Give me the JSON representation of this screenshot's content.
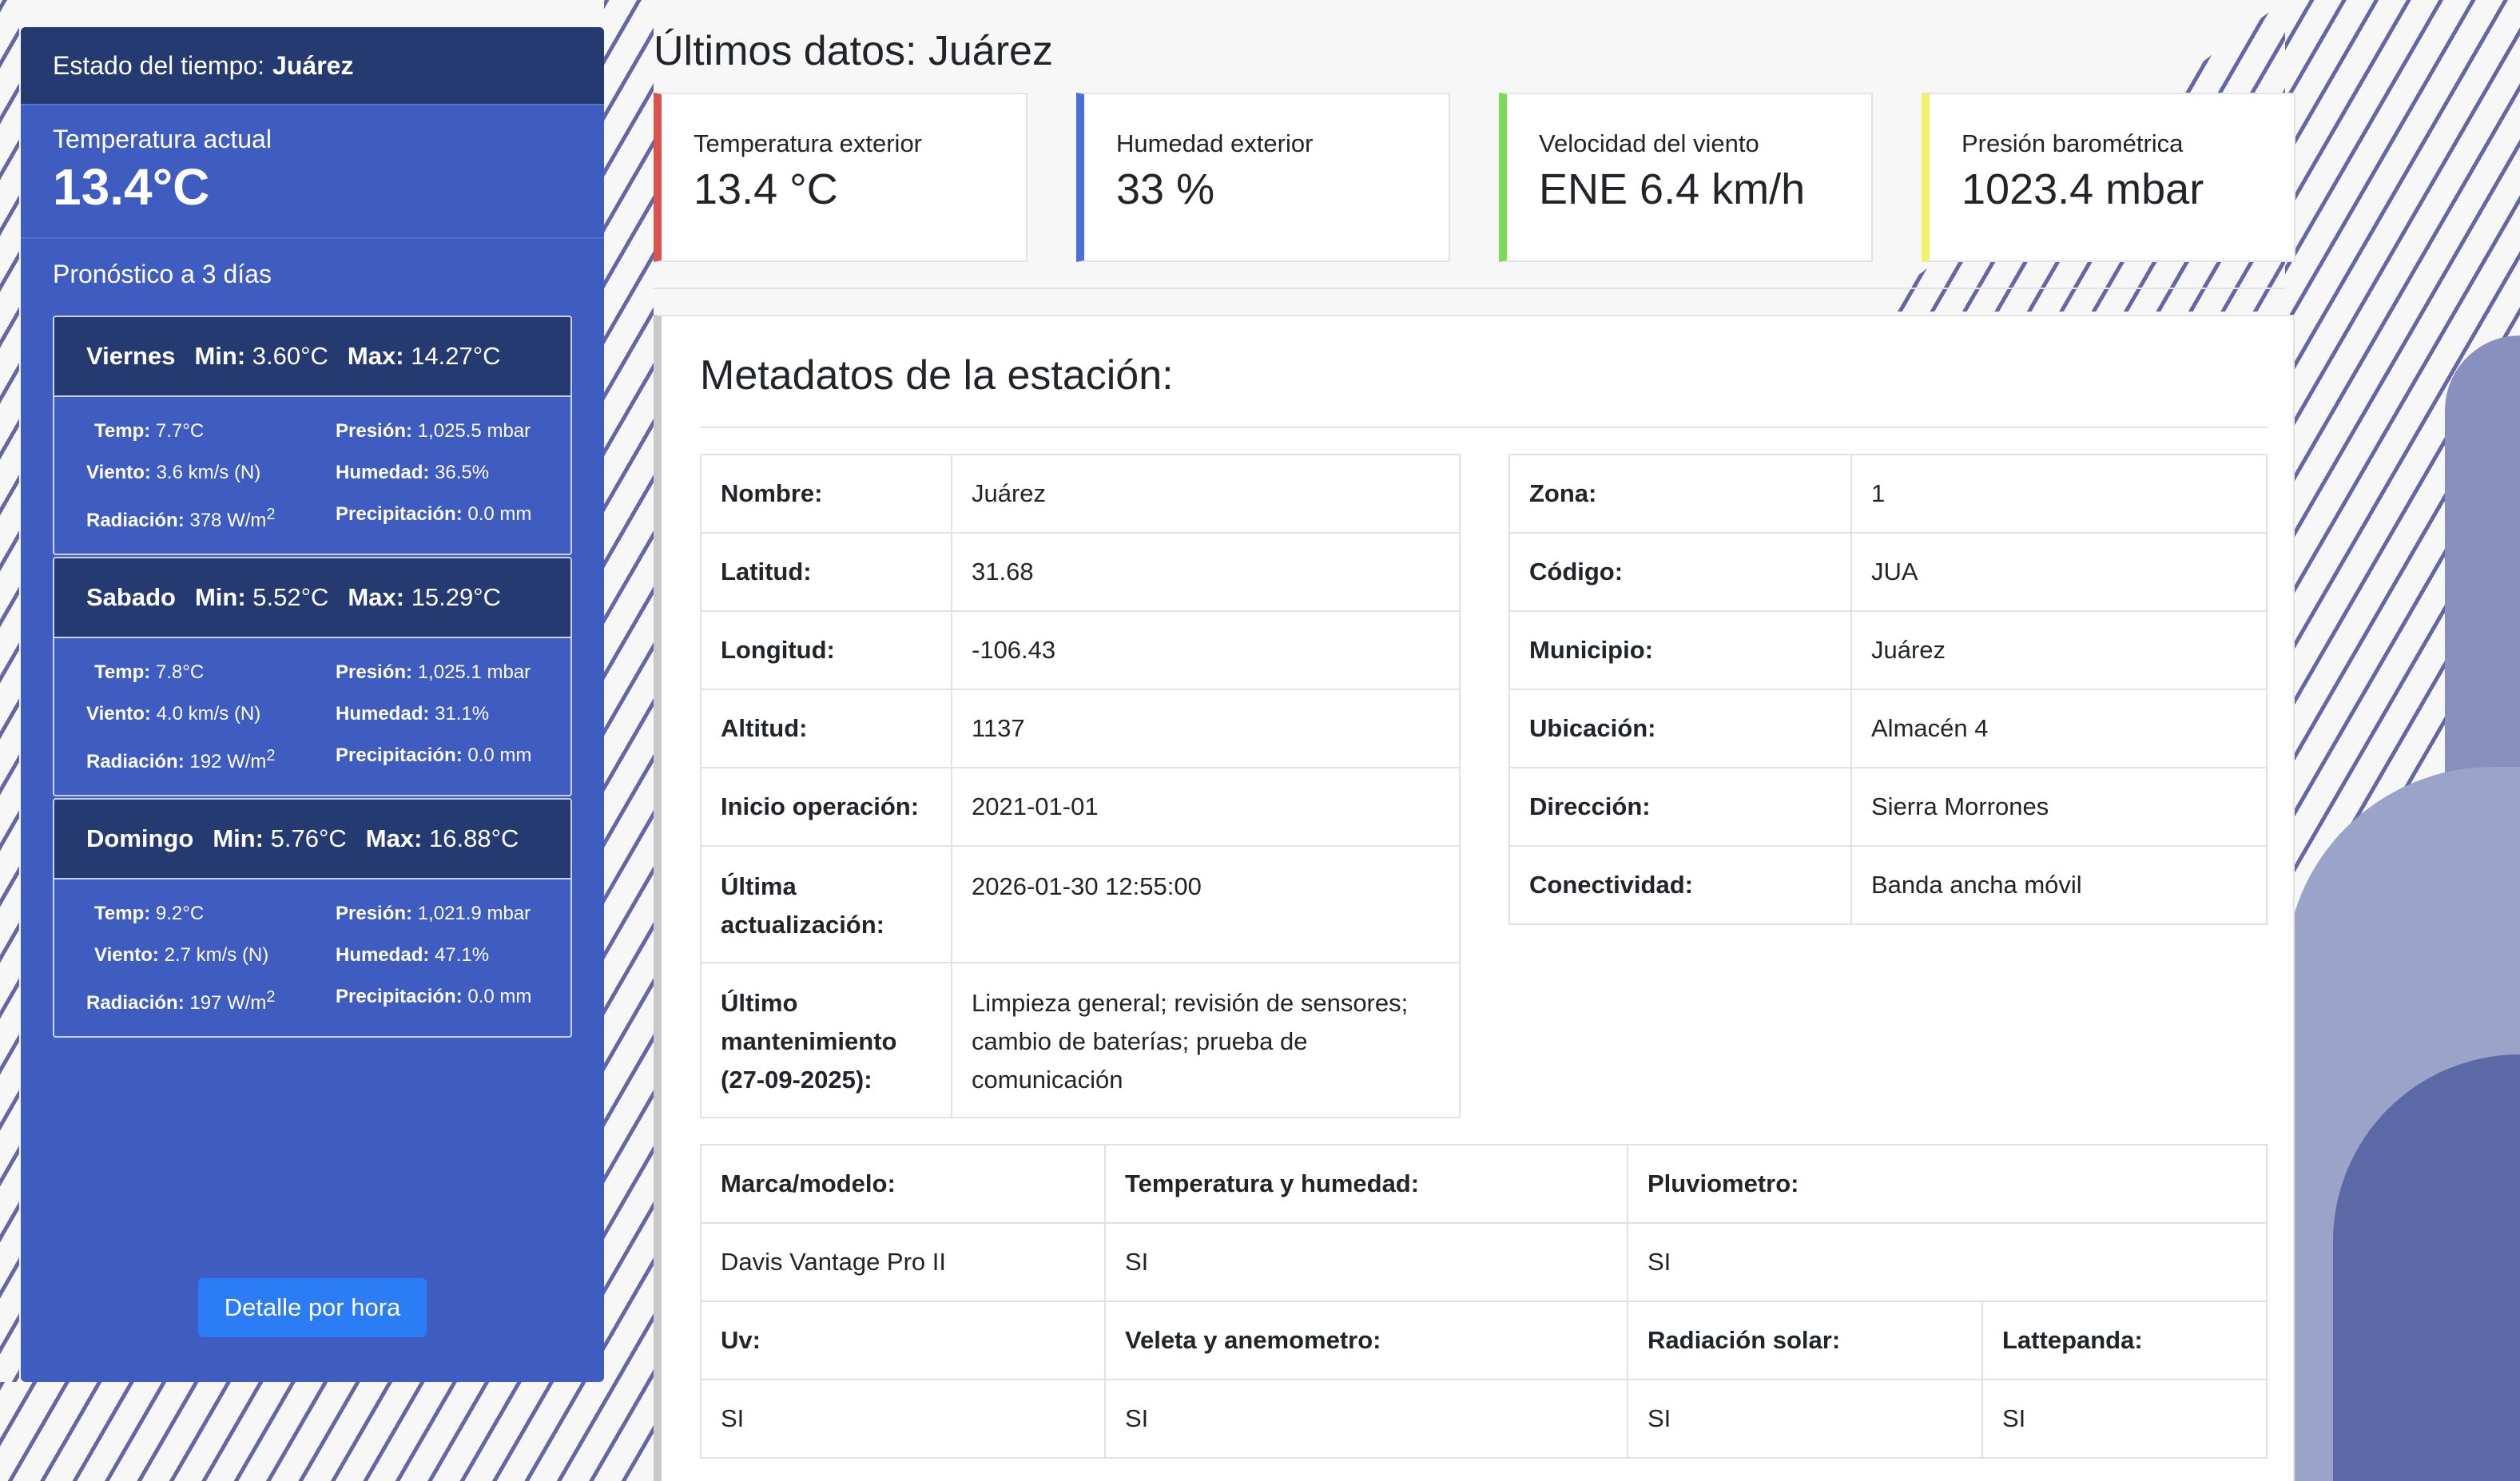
{
  "sidebar": {
    "header_prefix": "Estado del tiempo:",
    "header_station": "Juárez",
    "current_label": "Temperatura actual",
    "current_value": "13.4°C",
    "forecast_title": "Pronóstico a 3 días",
    "days": [
      {
        "name": "Viernes",
        "min_label": "Min:",
        "min": "3.60°C",
        "max_label": "Max:",
        "max": "14.27°C",
        "temp_label": "Temp:",
        "temp": "7.7°C",
        "pres_label": "Presión:",
        "pres": "1,025.5 mbar",
        "wind_label": "Viento:",
        "wind": "3.6 km/s (N)",
        "hum_label": "Humedad:",
        "hum": "36.5%",
        "rad_label": "Radiación:",
        "rad": "378 W/m",
        "rad_sup": "2",
        "prec_label": "Precipitación:",
        "prec": "0.0 mm"
      },
      {
        "name": "Sabado",
        "min_label": "Min:",
        "min": "5.52°C",
        "max_label": "Max:",
        "max": "15.29°C",
        "temp_label": "Temp:",
        "temp": "7.8°C",
        "pres_label": "Presión:",
        "pres": "1,025.1 mbar",
        "wind_label": "Viento:",
        "wind": "4.0 km/s (N)",
        "hum_label": "Humedad:",
        "hum": "31.1%",
        "rad_label": "Radiación:",
        "rad": "192 W/m",
        "rad_sup": "2",
        "prec_label": "Precipitación:",
        "prec": "0.0 mm"
      },
      {
        "name": "Domingo",
        "min_label": "Min:",
        "min": "5.76°C",
        "max_label": "Max:",
        "max": "16.88°C",
        "temp_label": "Temp:",
        "temp": "9.2°C",
        "pres_label": "Presión:",
        "pres": "1,021.9 mbar",
        "wind_label": "Viento:",
        "wind": "2.7 km/s (N)",
        "hum_label": "Humedad:",
        "hum": "47.1%",
        "rad_label": "Radiación:",
        "rad": "197 W/m",
        "rad_sup": "2",
        "prec_label": "Precipitación:",
        "prec": "0.0 mm"
      }
    ],
    "detail_button": "Detalle por hora"
  },
  "main": {
    "title": "Últimos datos: Juárez",
    "stats": [
      {
        "label": "Temperatura exterior",
        "value": "13.4 °C",
        "color": "#d9534f"
      },
      {
        "label": "Humedad exterior",
        "value": "33 %",
        "color": "#4a6fdc"
      },
      {
        "label": "Velocidad del viento",
        "value": "ENE 6.4 km/h",
        "color": "#7ed957"
      },
      {
        "label": "Presión barométrica",
        "value": "1023.4 mbar",
        "color": "#f0f36a"
      }
    ],
    "metadata_title": "Metadatos de la estación:",
    "left_table": [
      {
        "k": "Nombre:",
        "v": "Juárez"
      },
      {
        "k": "Latitud:",
        "v": "31.68"
      },
      {
        "k": "Longitud:",
        "v": "-106.43"
      },
      {
        "k": "Altitud:",
        "v": "1137"
      },
      {
        "k": "Inicio operación:",
        "v": "2021-01-01"
      },
      {
        "k": "Última actualización:",
        "v": "2026-01-30 12:55:00"
      },
      {
        "k": "Último mantenimiento (27-09-2025):",
        "v": "Limpieza general; revisión de sensores; cambio de baterías; prueba de comunicación"
      }
    ],
    "right_table": [
      {
        "k": "Zona:",
        "v": "1"
      },
      {
        "k": "Código:",
        "v": "JUA"
      },
      {
        "k": "Municipio:",
        "v": "Juárez"
      },
      {
        "k": "Ubicación:",
        "v": "Almacén 4"
      },
      {
        "k": "Dirección:",
        "v": "Sierra Morrones"
      },
      {
        "k": "Conectividad:",
        "v": "Banda ancha móvil"
      }
    ],
    "equipment": {
      "row1_headers": [
        "Marca/modelo:",
        "Temperatura y humedad:",
        "Pluviometro:"
      ],
      "row1_values": [
        "Davis Vantage Pro II",
        "SI",
        "SI"
      ],
      "row2_headers": [
        "Uv:",
        "Veleta y anemometro:",
        "Radiación solar:",
        "Lattepanda:"
      ],
      "row2_values": [
        "SI",
        "SI",
        "SI",
        "SI"
      ]
    }
  }
}
